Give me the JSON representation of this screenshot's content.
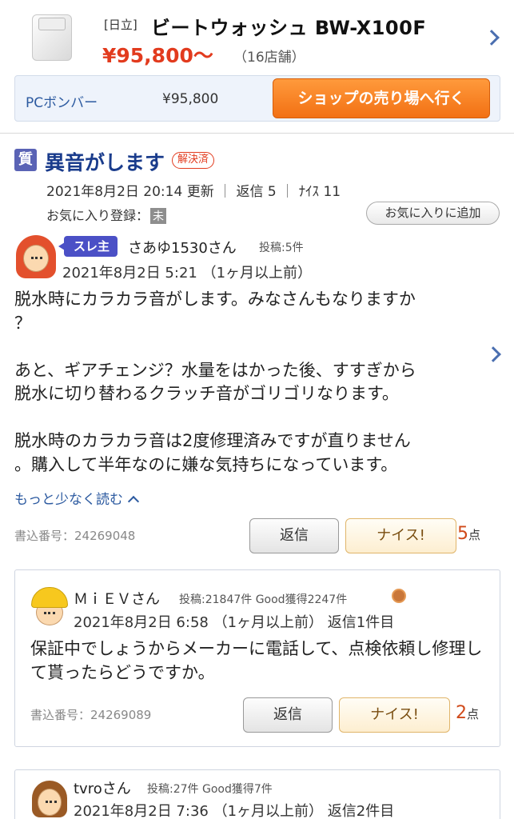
{
  "product": {
    "maker": "[日立]",
    "name": "ビートウォッシュ BW-X100F",
    "price": "¥95,800〜",
    "shops": "（16店舗）",
    "shop_name": "PCボンバー",
    "shop_price": "¥95,800",
    "shop_button": "ショップの売り場へ行く"
  },
  "thread": {
    "type_icon": "質",
    "title": "異音がします",
    "status": "解決済",
    "updated": "2021年8月2日 20:14 更新",
    "replies": "返信 5",
    "nice": "ﾅｲｽ 11",
    "fav_label": "お気に入り登録：",
    "fav_value": "未",
    "fav_button": "お気に入りに追加"
  },
  "post": {
    "badge": "スレ主",
    "user": "さあゆ1530さん",
    "stats": "投稿:5件",
    "date": "2021年8月2日 5:21 （1ヶ月以上前）",
    "body": "脱水時にカラカラ音がします。みなさんもなりますか\n？\n\nあと、ギアチェンジ？水量をはかった後、すすぎから\n脱水に切り替わるクラッチ音がゴリゴリなります。\n\n脱水時のカラカラ音は2度修理済みですが直りません\n。購入して半年なのに嫌な気持ちになっています。",
    "read_less": "もっと少なく読む",
    "post_no": "書込番号：24269048",
    "reply_button": "返信",
    "nice_button": "ナイス!",
    "score": "5",
    "score_unit": "点"
  },
  "replies": [
    {
      "user": "ＭｉＥＶさん",
      "stats": "投稿:21847件 Good獲得2247件",
      "date": "2021年8月2日 6:58 （1ヶ月以上前） 返信1件目",
      "body": "保証中でしょうからメーカーに電話して、点検依頼し修理して貰ったらどうですか。",
      "post_no": "書込番号：24269089",
      "reply_button": "返信",
      "nice_button": "ナイス!",
      "score": "2",
      "score_unit": "点"
    },
    {
      "user": "tvroさん",
      "stats": "投稿:27件 Good獲得7件",
      "date": "2021年8月2日 7:36 （1ヶ月以上前） 返信2件目"
    }
  ],
  "colors": {
    "accent_blue": "#1a3c8c",
    "link_blue": "#2c5aa0",
    "price_red": "#e23b1e",
    "shop_orange": "#f27013",
    "op_badge": "#4b50c6"
  }
}
